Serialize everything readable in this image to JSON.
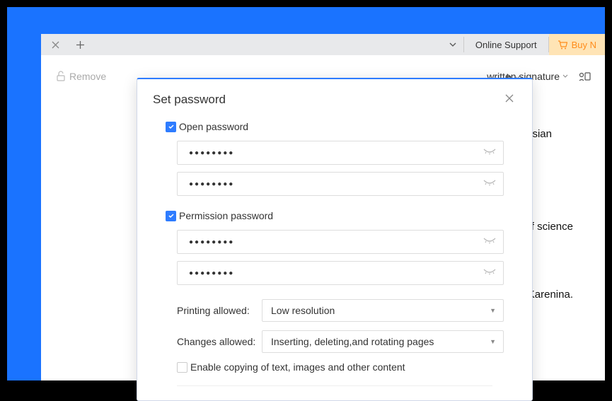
{
  "tabbar": {
    "online_support": "Online Support",
    "buy_label": "Buy N"
  },
  "toolbar": {
    "remove_label": "Remove",
    "signature_label": "written signature",
    "lang_fragment": "h"
  },
  "background": {
    "line1": "olynesian",
    "line2": "of science",
    "line3": "Karenina."
  },
  "modal": {
    "title": "Set password",
    "open_password_label": "Open password",
    "permission_password_label": "Permission password",
    "pw_mask": "●●●●●●●●",
    "printing_label": "Printing allowed:",
    "printing_value": "Low resolution",
    "changes_label": "Changes allowed:",
    "changes_value": "Inserting, deleting,and rotating pages",
    "copy_label": "Enable copying of text, images and other content"
  }
}
